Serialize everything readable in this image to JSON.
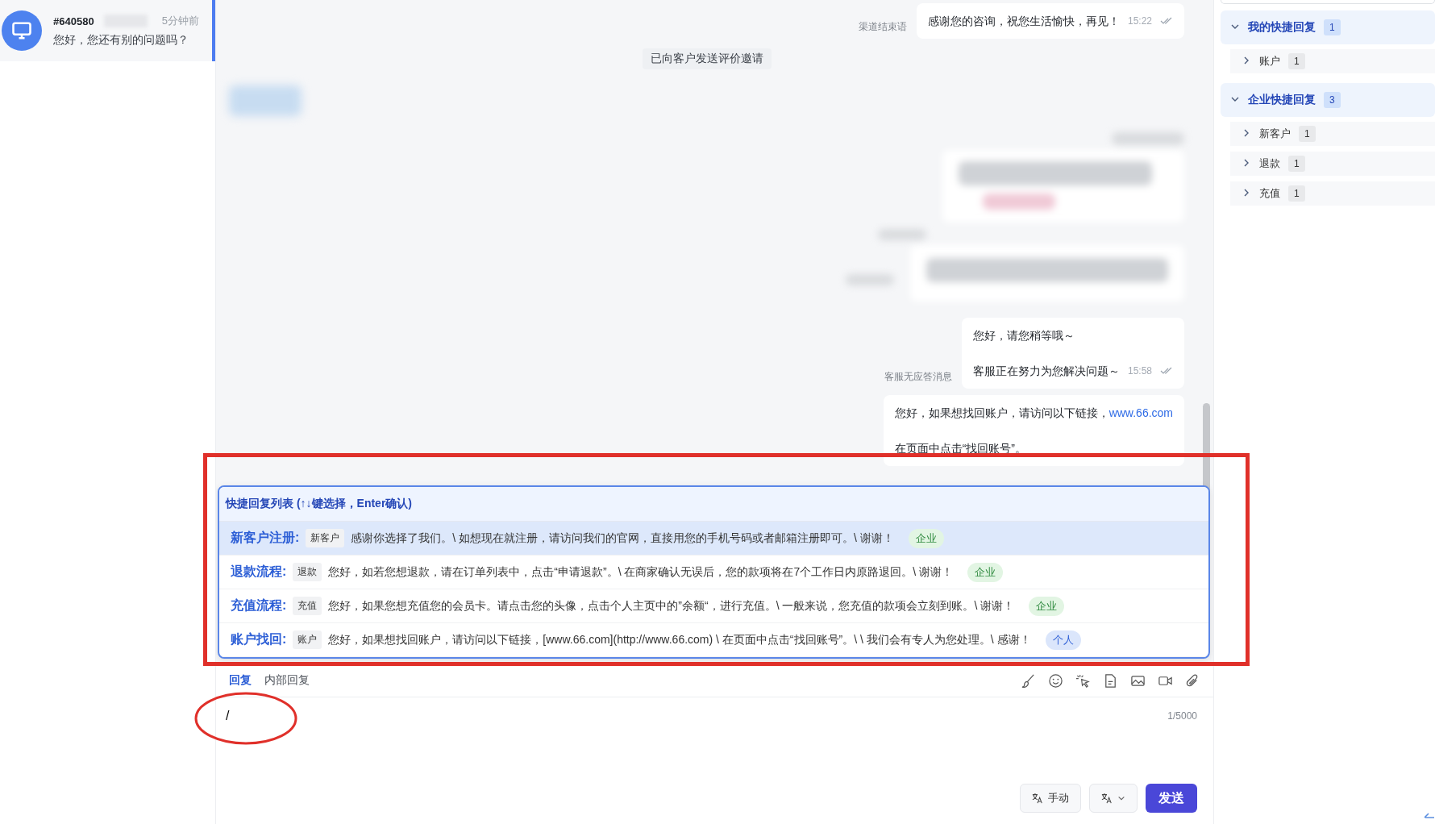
{
  "conversations": [
    {
      "number": "#640580",
      "time": "5分钟前",
      "preview": "您好，您还有别的问题吗？",
      "selected": true
    }
  ],
  "messages": [
    {
      "kind": "agent",
      "label": "渠道结束语",
      "paragraphs": [
        {
          "text": "感谢您的咨询，祝您生活愉快，再见！"
        }
      ],
      "time": "15:22",
      "read": true
    },
    {
      "kind": "notice",
      "text": "已向客户发送评价邀请"
    },
    {
      "kind": "blurred_customer"
    },
    {
      "kind": "blurred_agent"
    },
    {
      "kind": "agent",
      "label": "客服无应答消息",
      "paragraphs": [
        {
          "text": "您好，请您稍等哦～"
        },
        {
          "text": "客服正在努力为您解决问题～"
        }
      ],
      "time": "15:58",
      "read": true
    },
    {
      "kind": "agent",
      "paragraphs": [
        {
          "text": "您好，如果想找回账户，请访问以下链接，",
          "link": "www.66.com"
        },
        {
          "text": "在页面中点击“找回账号”。"
        }
      ]
    }
  ],
  "quick_reply_popup": {
    "header": "快捷回复列表 (↑↓键选择，Enter确认)",
    "items": [
      {
        "title": "新客户注册:",
        "tag": "新客户",
        "content": "感谢你选择了我们。\\ 如想现在就注册，请访问我们的官网，直接用您的手机号码或者邮箱注册即可。\\ 谢谢！",
        "scope": {
          "label": "企业",
          "kind": "enterprise"
        },
        "selected": true
      },
      {
        "title": "退款流程:",
        "tag": "退款",
        "content": "您好，如若您想退款，请在订单列表中，点击“申请退款”。\\ 在商家确认无误后，您的款项将在7个工作日内原路退回。\\ 谢谢！",
        "scope": {
          "label": "企业",
          "kind": "enterprise"
        },
        "selected": false
      },
      {
        "title": "充值流程:",
        "tag": "充值",
        "content": "您好，如果您想充值您的会员卡。请点击您的头像，点击个人主页中的”余额“，进行充值。\\ 一般来说，您充值的款项会立刻到账。\\ 谢谢！",
        "scope": {
          "label": "企业",
          "kind": "enterprise"
        },
        "selected": false
      },
      {
        "title": "账户找回:",
        "tag": "账户",
        "content": "您好，如果想找回账户，请访问以下链接，[www.66.com](http://www.66.com) \\ 在页面中点击“找回账号”。\\ \\ 我们会有专人为您处理。\\ 感谢！",
        "scope": {
          "label": "个人",
          "kind": "personal"
        },
        "selected": false
      }
    ]
  },
  "composer": {
    "tabs": [
      {
        "label": "回复",
        "selected": true
      },
      {
        "label": "内部回复",
        "selected": false
      }
    ],
    "input": {
      "value": "/"
    },
    "counter": "1/5000",
    "translate_mode": "手动",
    "send": "发送"
  },
  "quick_replies": [
    {
      "label": "我的快捷回复",
      "count": "1",
      "expanded": true,
      "children": [
        {
          "label": "账户",
          "count": "1",
          "expanded": false
        }
      ]
    },
    {
      "label": "企业快捷回复",
      "count": "3",
      "expanded": true,
      "children": [
        {
          "label": "新客户",
          "count": "1",
          "expanded": false
        },
        {
          "label": "退款",
          "count": "1",
          "expanded": false
        },
        {
          "label": "充值",
          "count": "1",
          "expanded": false
        }
      ]
    }
  ]
}
